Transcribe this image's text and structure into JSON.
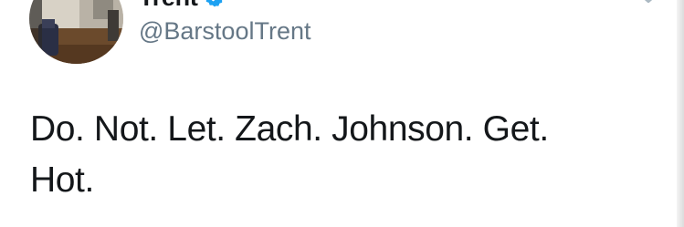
{
  "tweet": {
    "author": {
      "display_name": "Trent",
      "handle": "@BarstoolTrent",
      "verified": true,
      "avatar_icon": "profile-photo"
    },
    "text": "Do. Not. Let. Zach. Johnson. Get.\nHot.",
    "menu_icon": "chevron-down-icon"
  },
  "colors": {
    "text_primary": "#14171a",
    "text_secondary": "#657786",
    "verified_blue": "#1da1f2",
    "background": "#ffffff"
  }
}
